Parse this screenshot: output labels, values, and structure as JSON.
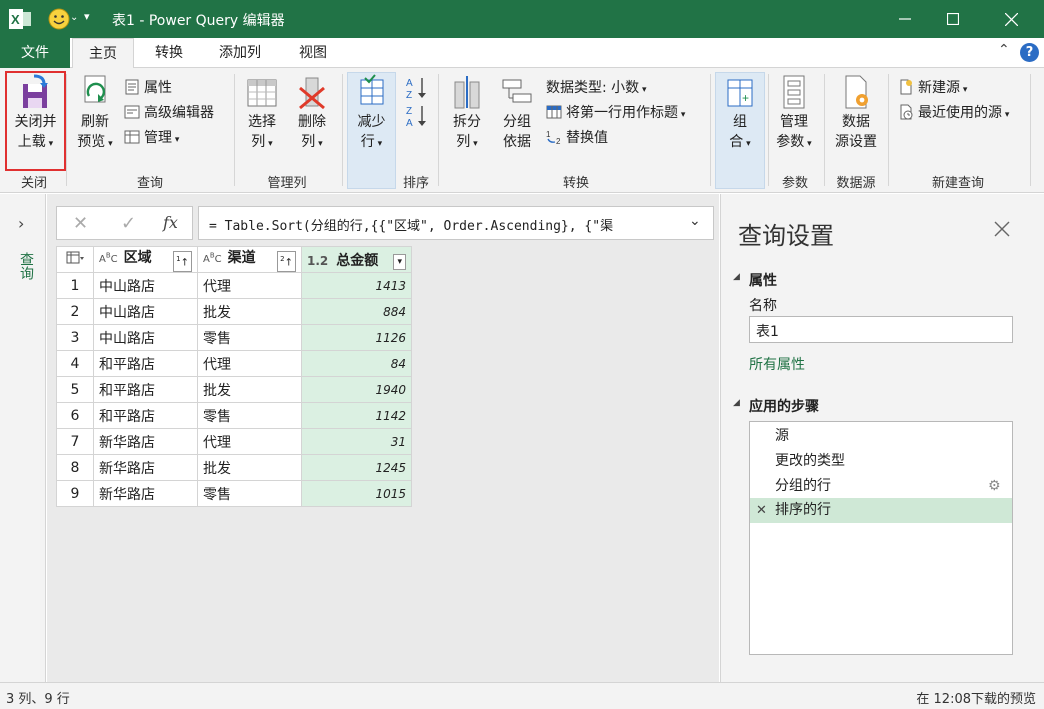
{
  "window": {
    "title": "表1 - Power Query 编辑器"
  },
  "tabs": {
    "file": "文件",
    "home": "主页",
    "transform": "转换",
    "add_column": "添加列",
    "view": "视图"
  },
  "ribbon": {
    "close": {
      "line1": "关闭并",
      "line2": "上载",
      "group": "关闭"
    },
    "query": {
      "refresh_line1": "刷新",
      "refresh_line2": "预览",
      "properties": "属性",
      "advanced_editor": "高级编辑器",
      "manage": "管理",
      "group": "查询"
    },
    "manage_columns": {
      "choose_line1": "选择",
      "choose_line2": "列",
      "remove_line1": "删除",
      "remove_line2": "列",
      "group": "管理列"
    },
    "reduce_rows": {
      "line1": "减少",
      "line2": "行"
    },
    "sort": {
      "group": "排序"
    },
    "transform": {
      "split_line1": "拆分",
      "split_line2": "列",
      "groupby_line1": "分组",
      "groupby_line2": "依据",
      "data_type": "数据类型: 小数",
      "first_row_header": "将第一行用作标题",
      "replace_values": "替换值",
      "group": "转换"
    },
    "combine": {
      "line1": "组",
      "line2": "合"
    },
    "parameters": {
      "line1": "管理",
      "line2": "参数",
      "group": "参数"
    },
    "datasource": {
      "line1": "数据",
      "line2": "源设置",
      "group": "数据源"
    },
    "new_query": {
      "new_source": "新建源",
      "recent_sources": "最近使用的源",
      "group": "新建查询"
    }
  },
  "leftpane": {
    "label": "查询"
  },
  "formula": {
    "text": "= Table.Sort(分组的行,{{\"区域\", Order.Ascending}, {\"渠",
    "fx": "fx"
  },
  "grid": {
    "columns": [
      {
        "type": "ABC",
        "name": "区域",
        "sort": "1"
      },
      {
        "type": "ABC",
        "name": "渠道",
        "sort": "2"
      },
      {
        "type": "1.2",
        "name": "总金额"
      }
    ],
    "rows": [
      {
        "n": "1",
        "region": "中山路店",
        "channel": "代理",
        "amount": "1413"
      },
      {
        "n": "2",
        "region": "中山路店",
        "channel": "批发",
        "amount": "884"
      },
      {
        "n": "3",
        "region": "中山路店",
        "channel": "零售",
        "amount": "1126"
      },
      {
        "n": "4",
        "region": "和平路店",
        "channel": "代理",
        "amount": "84"
      },
      {
        "n": "5",
        "region": "和平路店",
        "channel": "批发",
        "amount": "1940"
      },
      {
        "n": "6",
        "region": "和平路店",
        "channel": "零售",
        "amount": "1142"
      },
      {
        "n": "7",
        "region": "新华路店",
        "channel": "代理",
        "amount": "31"
      },
      {
        "n": "8",
        "region": "新华路店",
        "channel": "批发",
        "amount": "1245"
      },
      {
        "n": "9",
        "region": "新华路店",
        "channel": "零售",
        "amount": "1015"
      }
    ]
  },
  "settings": {
    "title": "查询设置",
    "properties_heading": "属性",
    "name_label": "名称",
    "name_value": "表1",
    "all_properties": "所有属性",
    "steps_heading": "应用的步骤",
    "steps": [
      "源",
      "更改的类型",
      "分组的行",
      "排序的行"
    ]
  },
  "status": {
    "left": "3 列、9 行",
    "right": "在 12:08下载的预览"
  },
  "colors": {
    "brand": "#217346",
    "highlight_red": "#e03030",
    "number_column": "#dbf0e2",
    "selected_step": "#cfe8d6"
  }
}
